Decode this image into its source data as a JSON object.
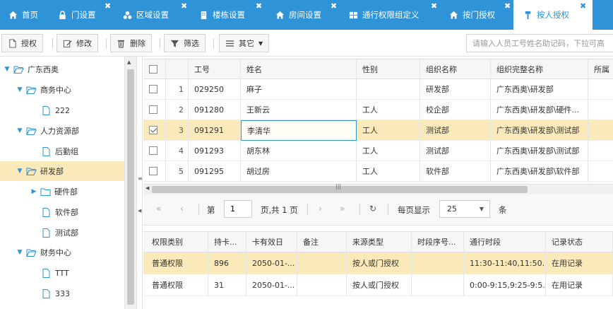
{
  "tabs": [
    {
      "label": "首页",
      "icon": "home-icon",
      "closable": false,
      "active": false
    },
    {
      "label": "门设置",
      "icon": "lock-icon",
      "closable": true,
      "active": false
    },
    {
      "label": "区域设置",
      "icon": "nodes-icon",
      "closable": true,
      "active": false
    },
    {
      "label": "楼栋设置",
      "icon": "building-icon",
      "closable": true,
      "active": false
    },
    {
      "label": "房间设置",
      "icon": "home-icon",
      "closable": true,
      "active": false
    },
    {
      "label": "通行权限组定义",
      "icon": "grid-icon",
      "closable": true,
      "active": false
    },
    {
      "label": "按门授权",
      "icon": "home-icon",
      "closable": true,
      "active": false
    },
    {
      "label": "按人授权",
      "icon": "person-pin-icon",
      "closable": true,
      "active": true
    }
  ],
  "toolbar": {
    "authorize": "授权",
    "edit": "修改",
    "delete": "删除",
    "filter": "筛选",
    "other": "其它",
    "search_placeholder": "请输入人员工号姓名助记码，下拉可高"
  },
  "tree": [
    {
      "label": "广东西奥",
      "type": "folder",
      "expanded": true,
      "level": 0
    },
    {
      "label": "商务中心",
      "type": "folder",
      "expanded": true,
      "level": 1
    },
    {
      "label": "222",
      "type": "file",
      "level": 2
    },
    {
      "label": "人力资源部",
      "type": "folder",
      "expanded": true,
      "level": 1
    },
    {
      "label": "后勤组",
      "type": "file",
      "level": 2
    },
    {
      "label": "研发部",
      "type": "folder",
      "expanded": true,
      "level": 1,
      "selected": true
    },
    {
      "label": "硬件部",
      "type": "folder",
      "expanded": false,
      "level": 2
    },
    {
      "label": "软件部",
      "type": "file",
      "level": 2
    },
    {
      "label": "测试部",
      "type": "file",
      "level": 2
    },
    {
      "label": "财务中心",
      "type": "folder",
      "expanded": true,
      "level": 1
    },
    {
      "label": "TTT",
      "type": "file",
      "level": 2
    },
    {
      "label": "333",
      "type": "file",
      "level": 2
    }
  ],
  "grid": {
    "columns": [
      "工号",
      "姓名",
      "性别",
      "组织名称",
      "组织完整名称",
      "所属"
    ],
    "rows": [
      {
        "n": "1",
        "id": "029250",
        "name": "麻子",
        "gender": "",
        "org": "研发部",
        "full": "广东西奥\\研发部",
        "checked": false
      },
      {
        "n": "2",
        "id": "091280",
        "name": "王新云",
        "gender": "工人",
        "org": "校企部",
        "full": "广东西奥\\研发部\\硬件...",
        "checked": false
      },
      {
        "n": "3",
        "id": "091291",
        "name": "李清华",
        "gender": "工人",
        "org": "测试部",
        "full": "广东西奥\\研发部\\测试部",
        "checked": true
      },
      {
        "n": "4",
        "id": "091293",
        "name": "胡东林",
        "gender": "工人",
        "org": "测试部",
        "full": "广东西奥\\研发部\\测试部",
        "checked": false
      },
      {
        "n": "5",
        "id": "091295",
        "name": "胡过房",
        "gender": "工人",
        "org": "软件部",
        "full": "广东西奥\\研发部\\软件部",
        "checked": false
      }
    ]
  },
  "pager": {
    "page_label": "第",
    "page_value": "1",
    "total": "页,共 1 页",
    "show_label": "每页显示",
    "page_size": "25",
    "unit": "条"
  },
  "sub": {
    "columns": [
      "权限类别",
      "持卡...",
      "卡有效日",
      "备注",
      "来源类型",
      "时段序号...",
      "通行时段",
      "记录状态"
    ],
    "rows": [
      {
        "type": "普通权限",
        "card": "896",
        "valid": "2050-01-...",
        "note": "",
        "source": "按人或门授权",
        "seq": "",
        "period": "11:30-11:40,11:50...",
        "status": "在用记录"
      },
      {
        "type": "普通权限",
        "card": "31",
        "valid": "2050-01-...",
        "note": "",
        "source": "按人或门授权",
        "seq": "",
        "period": "0:00-9:15,9:25-9:5...",
        "status": "在用记录"
      }
    ]
  },
  "colors": {
    "accent": "#2f93d7",
    "selected_row": "#fbeab9"
  }
}
